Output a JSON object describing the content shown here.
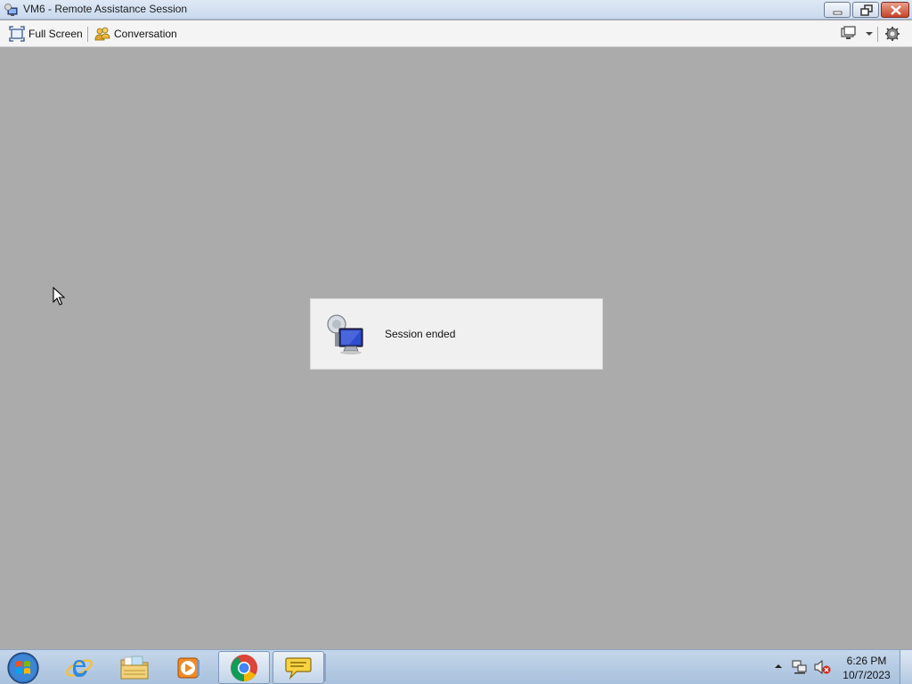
{
  "window": {
    "title": "VM6 - Remote Assistance Session",
    "controls": {
      "minimize": "minimize-icon",
      "maximize": "restore-icon",
      "close": "close-icon"
    }
  },
  "toolbar": {
    "full_screen_label": "Full Screen",
    "conversation_label": "Conversation",
    "icons": [
      "full-screen-icon",
      "conversation-icon",
      "display-icon",
      "settings-icon"
    ]
  },
  "session": {
    "message": "Session ended",
    "icon": "remote-assistance-icon"
  },
  "taskbar": {
    "apps": [
      "internet-explorer-icon",
      "file-explorer-icon",
      "media-player-icon",
      "chrome-icon",
      "chat-bubble-icon"
    ],
    "clock": {
      "time": "6:26 PM",
      "date": "10/7/2023"
    },
    "tray": [
      "show-hidden-icons-icon",
      "network-icon",
      "volume-muted-icon"
    ]
  },
  "colors": {
    "remote_background": "#ababab",
    "taskbar": "#b7cce4",
    "dialog": "#f0f0f0"
  }
}
